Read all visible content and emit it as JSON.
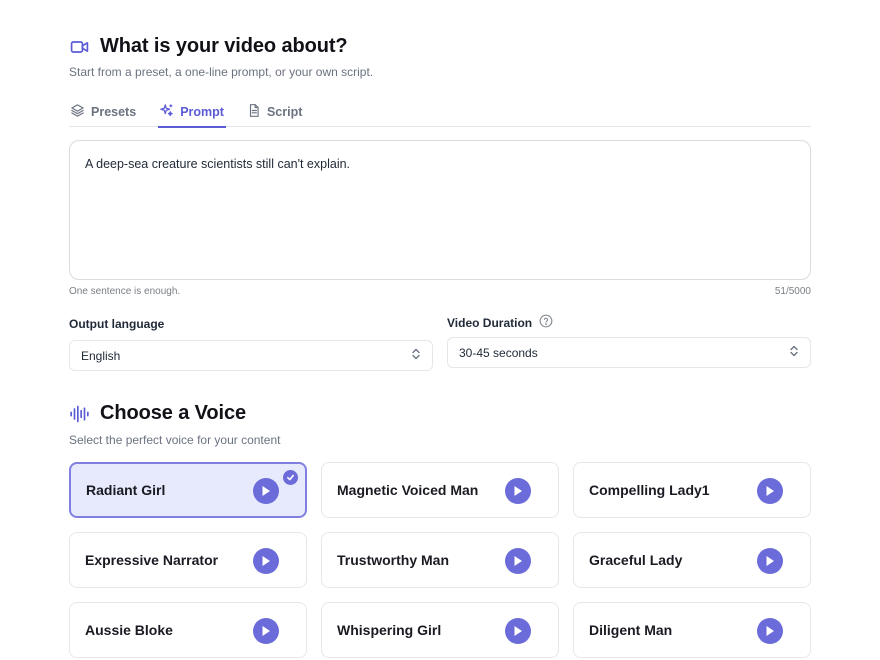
{
  "header": {
    "icon": "video-camera-icon",
    "title": "What is your video about?",
    "subtitle": "Start from a preset, a one-line prompt, or your own script."
  },
  "tabs": [
    {
      "label": "Presets",
      "icon": "layers-icon",
      "active": false
    },
    {
      "label": "Prompt",
      "icon": "sparkles-icon",
      "active": true
    },
    {
      "label": "Script",
      "icon": "document-icon",
      "active": false
    }
  ],
  "prompt": {
    "value": "A deep-sea creature scientists still can't explain.",
    "hint": "One sentence is enough.",
    "counter": "51/5000"
  },
  "language": {
    "label": "Output language",
    "value": "English"
  },
  "duration": {
    "label": "Video Duration",
    "value": "30-45 seconds"
  },
  "voice": {
    "icon": "audio-waveform-icon",
    "title": "Choose a Voice",
    "subtitle": "Select the perfect voice for your content",
    "items": [
      {
        "name": "Radiant Girl",
        "selected": true
      },
      {
        "name": "Magnetic Voiced Man",
        "selected": false
      },
      {
        "name": "Compelling Lady1",
        "selected": false
      },
      {
        "name": "Expressive Narrator",
        "selected": false
      },
      {
        "name": "Trustworthy Man",
        "selected": false
      },
      {
        "name": "Graceful Lady",
        "selected": false
      },
      {
        "name": "Aussie Bloke",
        "selected": false
      },
      {
        "name": "Whispering Girl",
        "selected": false
      },
      {
        "name": "Diligent Man",
        "selected": false
      }
    ]
  },
  "colors": {
    "accent": "#5b5bd6",
    "play_button": "#6b6bd9",
    "selected_card_bg": "#e7e9fd"
  }
}
